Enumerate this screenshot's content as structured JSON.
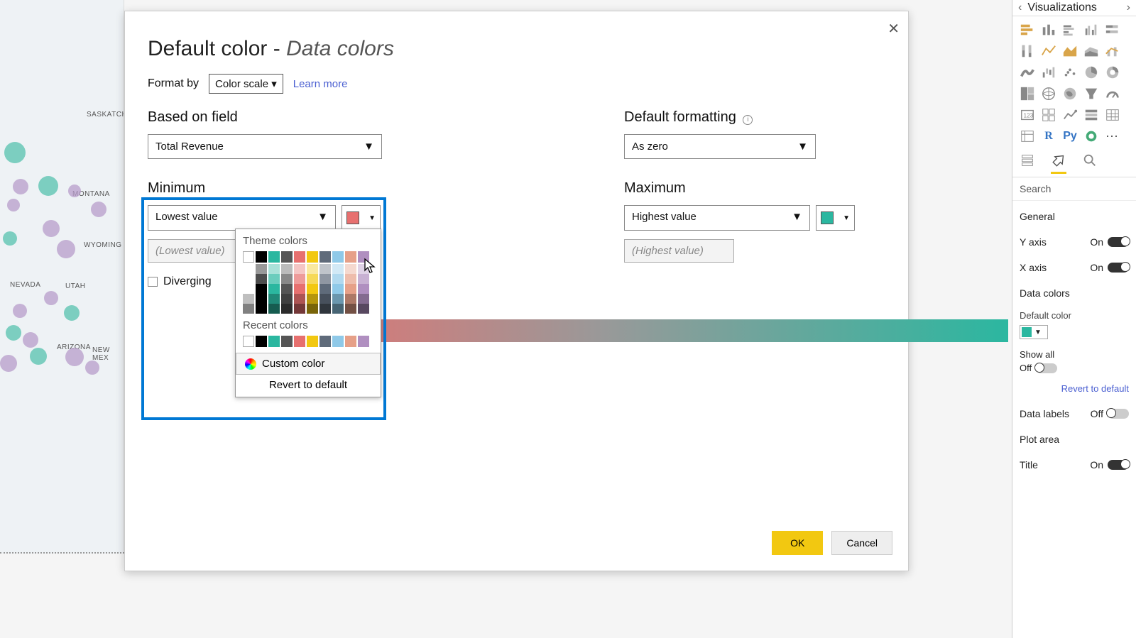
{
  "dialog": {
    "title_main": "Default color",
    "title_sep": " - ",
    "title_sub": "Data colors",
    "format_by_label": "Format by",
    "format_by_value": "Color scale ▾",
    "learn_more": "Learn more",
    "based_on_field_label": "Based on field",
    "based_on_field_value": "Total Revenue",
    "default_formatting_label": "Default formatting",
    "default_formatting_value": "As zero",
    "minimum_label": "Minimum",
    "minimum_sel": "Lowest value",
    "minimum_placeholder": "(Lowest value)",
    "min_color": "#e7706f",
    "maximum_label": "Maximum",
    "maximum_sel": "Highest value",
    "maximum_placeholder": "(Highest value)",
    "max_color": "#2bb7a0",
    "diverging_label": "Diverging",
    "ok": "OK",
    "cancel": "Cancel"
  },
  "picker": {
    "theme_title": "Theme colors",
    "theme_row": [
      "#ffffff",
      "#000000",
      "#2bb7a0",
      "#555555",
      "#e7706f",
      "#f2c811",
      "#5f6b7a",
      "#8fc9e8",
      "#e6a088",
      "#b08fc0"
    ],
    "recent_title": "Recent colors",
    "recent_row": [
      "#ffffff",
      "#000000",
      "#2bb7a0",
      "#555555",
      "#e7706f",
      "#f2c811",
      "#5f6b7a",
      "#8fc9e8",
      "#e6a088",
      "#b08fc0"
    ],
    "custom": "Custom color",
    "revert": "Revert to default"
  },
  "viz": {
    "title": "Visualizations",
    "search": "Search",
    "props": {
      "general": "General",
      "yaxis": "Y axis",
      "xaxis": "X axis",
      "datacolors": "Data colors",
      "defaultcolor": "Default color",
      "showall": "Show all",
      "off": "Off",
      "revert": "Revert to default",
      "datalabels": "Data labels",
      "plotarea": "Plot area",
      "title": "Title",
      "on": "On"
    }
  },
  "map": {
    "labels": [
      "SASKATCH",
      "MONTANA",
      "WYOMING",
      "UTAH",
      "NEVADA",
      "ARIZONA",
      "NEW MEX"
    ]
  }
}
